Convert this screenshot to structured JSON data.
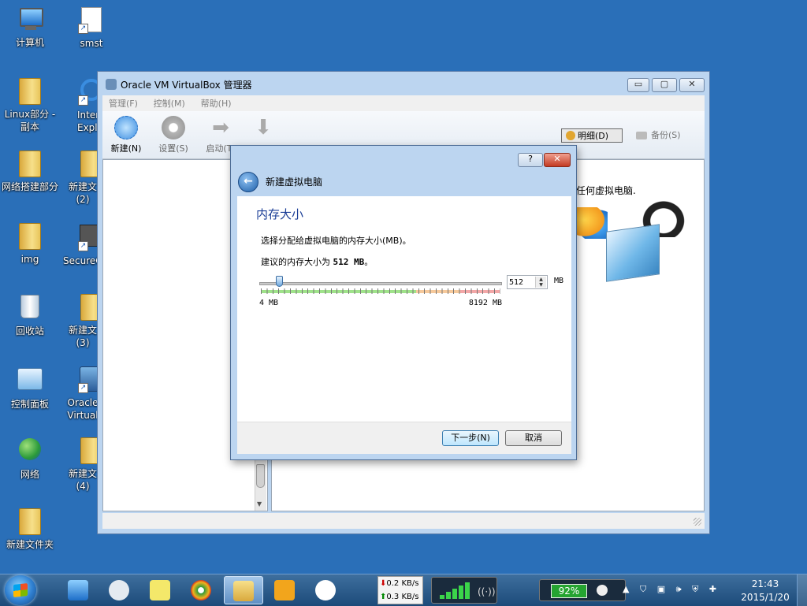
{
  "desktop": {
    "icons": [
      {
        "label": "计算机"
      },
      {
        "label": "smst"
      },
      {
        "label": "Linux部分 - 副本"
      },
      {
        "label": "Inter Explo"
      },
      {
        "label": "网络搭建部分"
      },
      {
        "label": "新建文 (2)"
      },
      {
        "label": "img"
      },
      {
        "label": "SecureC"
      },
      {
        "label": "回收站"
      },
      {
        "label": "新建文 (3)"
      },
      {
        "label": "控制面板"
      },
      {
        "label": "Oracle Virtual"
      },
      {
        "label": "网络"
      },
      {
        "label": "新建文 (4)"
      },
      {
        "label": "新建文件夹"
      }
    ]
  },
  "vbox": {
    "title": "Oracle VM VirtualBox 管理器",
    "caption": {
      "min": "▭",
      "max": "▢",
      "close": "✕"
    },
    "menu": [
      "管理(F)",
      "控制(M)",
      "帮助(H)"
    ],
    "toolbar": {
      "new": "新建(N)",
      "settings": "设置(S)",
      "start": "启动(T)",
      "discard": ""
    },
    "details_label": "明细(D)",
    "snapshots_label": "备份(S)",
    "welcome_text": "任何虚拟电脑."
  },
  "dialog": {
    "header": "新建虚拟电脑",
    "section_title": "内存大小",
    "instruction": "选择分配给虚拟电脑的内存大小(MB)。",
    "recommend_prefix": "建议的内存大小为 ",
    "recommend_value": "512 MB",
    "recommend_suffix": "。",
    "memory": {
      "value": "512",
      "min": 4,
      "max": 8192,
      "fraction": 0.062,
      "unit": "MB",
      "min_label": "4 MB",
      "max_label": "8192 MB"
    },
    "help_label": "?",
    "close_label": "✕",
    "back_label": "←",
    "next_label": "下一步(N)",
    "cancel_label": "取消"
  },
  "taskbar": {
    "net_down": "0.2 KB/s",
    "net_up": "0.3 KB/s",
    "battery": "92%",
    "time": "21:43",
    "date": "2015/1/20"
  }
}
